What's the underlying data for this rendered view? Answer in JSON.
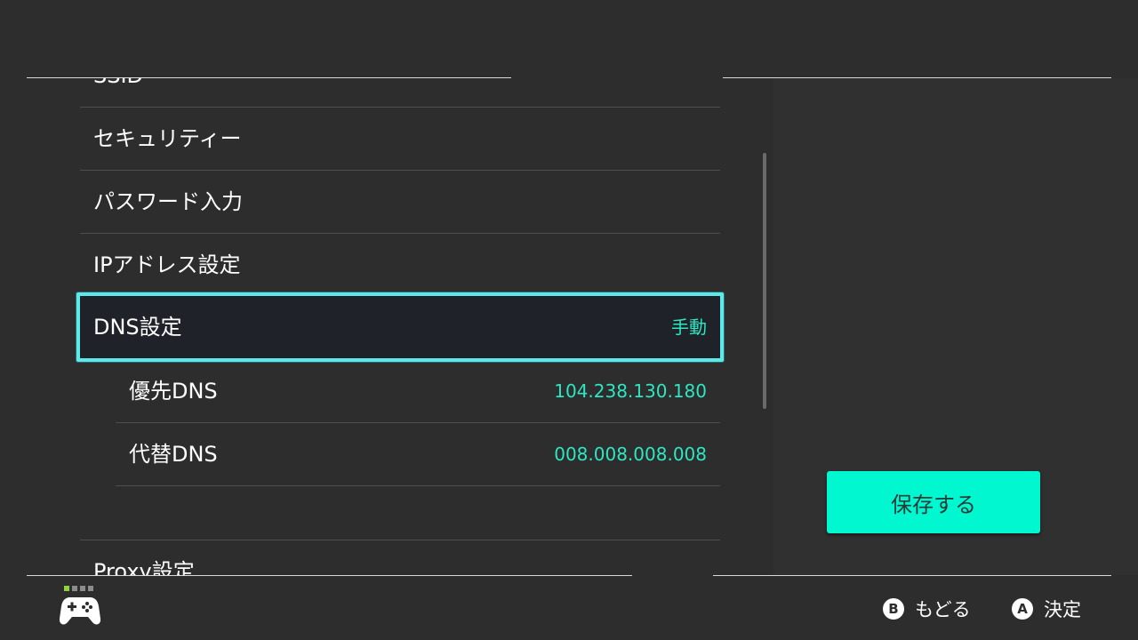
{
  "settings_list": {
    "items": [
      {
        "label": "SSID",
        "value": ""
      },
      {
        "label": "セキュリティー",
        "value": ""
      },
      {
        "label": "パスワード入力",
        "value": ""
      },
      {
        "label": "IPアドレス設定",
        "value": ""
      },
      {
        "label": "DNS設定",
        "value": "手動"
      },
      {
        "label": "優先DNS",
        "value": "104.238.130.180"
      },
      {
        "label": "代替DNS",
        "value": "008.008.008.008"
      },
      {
        "label": "Proxy設定",
        "value": ""
      }
    ],
    "selected_index": 4
  },
  "right_pane": {
    "save_label": "保存する"
  },
  "footer": {
    "back_glyph": "B",
    "back_label": "もどる",
    "confirm_glyph": "A",
    "confirm_label": "決定"
  },
  "icons": {
    "controller": "gamepad-icon"
  },
  "colors": {
    "background": "#2d2d2d",
    "accent": "#00f7cf",
    "value_text": "#2ee6c1",
    "selection_border": "#5ee8ea",
    "active_dot": "#8fd33a"
  }
}
